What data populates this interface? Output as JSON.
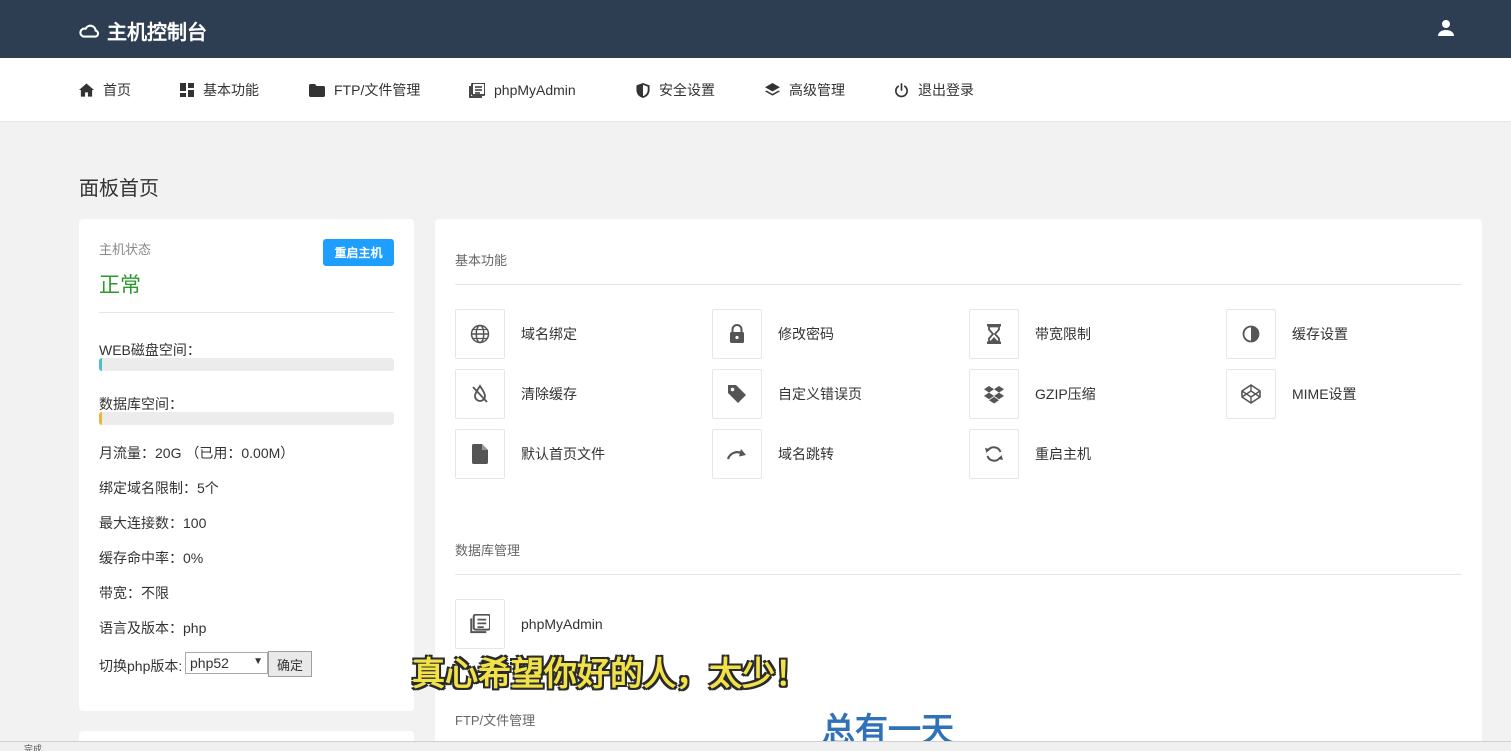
{
  "app": {
    "title": "主机控制台",
    "brand_icon": "cloud-icon",
    "user_icon": "user-icon"
  },
  "nav": {
    "items": [
      {
        "label": "首页",
        "icon": "home-icon"
      },
      {
        "label": "基本功能",
        "icon": "dashboard-icon"
      },
      {
        "label": "FTP/文件管理",
        "icon": "folder-icon"
      },
      {
        "label": "phpMyAdmin",
        "icon": "database-doc-icon"
      },
      {
        "label": "安全设置",
        "icon": "shield-icon"
      },
      {
        "label": "高级管理",
        "icon": "layers-icon"
      },
      {
        "label": "退出登录",
        "icon": "power-icon"
      }
    ]
  },
  "page": {
    "title": "面板首页"
  },
  "status": {
    "label": "主机状态",
    "value": "正常",
    "restart_button": "重启主机",
    "web_disk_label": "WEB磁盘空间：",
    "web_disk_fraction": 0.01,
    "db_space_label": "数据库空间：",
    "db_space_fraction": 0.01,
    "monthly_traffic": "月流量：20G （已用：0.00M）",
    "domain_limit": "绑定域名限制：5个",
    "max_connections": "最大连接数：100",
    "cache_hit": "缓存命中率：0%",
    "bandwidth": "带宽：不限",
    "language": "语言及版本：php",
    "switch_php_label": "切换php版本:",
    "php_selected": "php52",
    "confirm_button": "确定"
  },
  "basic": {
    "title": "基本功能",
    "tiles": [
      {
        "label": "域名绑定",
        "icon": "globe-icon"
      },
      {
        "label": "修改密码",
        "icon": "lock-icon"
      },
      {
        "label": "带宽限制",
        "icon": "hourglass-icon"
      },
      {
        "label": "缓存设置",
        "icon": "contrast-icon"
      },
      {
        "label": "清除缓存",
        "icon": "drop-slash-icon"
      },
      {
        "label": "自定义错误页",
        "icon": "tag-icon"
      },
      {
        "label": "GZIP压缩",
        "icon": "dropbox-icon"
      },
      {
        "label": "MIME设置",
        "icon": "codepen-icon"
      },
      {
        "label": "默认首页文件",
        "icon": "file-icon"
      },
      {
        "label": "域名跳转",
        "icon": "redo-icon"
      },
      {
        "label": "重启主机",
        "icon": "sync-icon"
      }
    ]
  },
  "database": {
    "title": "数据库管理",
    "tiles": [
      {
        "label": "phpMyAdmin",
        "icon": "database-doc-icon"
      }
    ]
  },
  "ftp": {
    "title": "FTP/文件管理"
  },
  "subtitles": {
    "line1": "真心希望你好的人，太少！",
    "line2": "总有一天"
  },
  "statusbar": {
    "text": "完成"
  },
  "colors": {
    "topbar": "#2e3e52",
    "accent": "#1e9fff",
    "ok": "#2b9a2b",
    "web_bar": "#4ac0d8",
    "db_bar": "#f0b33a"
  }
}
